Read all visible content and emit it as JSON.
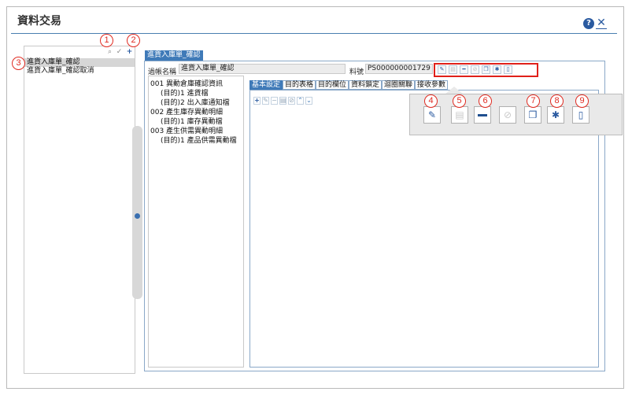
{
  "page": {
    "title": "資料交易"
  },
  "header": {
    "help_icon": "?",
    "close_icon": "✕"
  },
  "left_panel": {
    "items": [
      {
        "label": "進貨入庫單_確認",
        "selected": true
      },
      {
        "label": "進貨入庫單_確認取消",
        "selected": false
      }
    ]
  },
  "right_panel": {
    "tab_label": "進貨入庫單_確認",
    "account_name_label": "過帳名稱",
    "account_name_value": "進貨入庫單_確認",
    "number_label": "料號",
    "number_value": "PS000000001729"
  },
  "tree": {
    "items": [
      "001 異動倉庫確認資訊",
      "(目的)1 進貨檔",
      "(目的)2 出入庫通知檔",
      "002 產生庫存異動明細",
      "(目的)1 庫存異動檔",
      "003 產生供需異動明細",
      "(目的)1 產品供需異動檔"
    ]
  },
  "detail_tabs": [
    "基本設定",
    "目的表格",
    "目的欄位",
    "資料鎖定",
    "迴圈關聯",
    "接收參數"
  ],
  "markers": [
    "1",
    "2",
    "3",
    "4",
    "5",
    "6",
    "7",
    "8",
    "9"
  ],
  "icons": {
    "edit": "pencil-icon",
    "save": "save-icon",
    "delete": "minus-icon",
    "disable": "cancel-icon",
    "copy": "copy-icon",
    "debug": "bug-icon",
    "document": "document-icon"
  },
  "colors": {
    "accent": "#3f7ab8",
    "highlight": "#e0201a"
  }
}
